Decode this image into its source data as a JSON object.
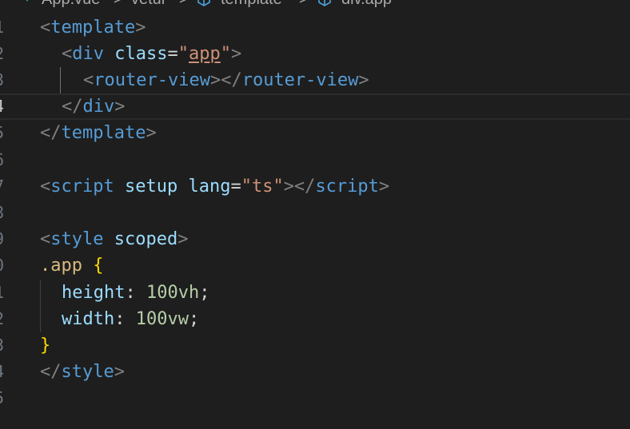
{
  "breadcrumb": {
    "items": [
      "App.vue",
      "vetur",
      "template",
      "div.app"
    ],
    "separator": ">"
  },
  "line_numbers": [
    "1",
    "2",
    "3",
    "4",
    "5",
    "6",
    "7",
    "8",
    "9",
    "0",
    "1",
    "2",
    "3",
    "4",
    "5"
  ],
  "active_line_index": 3,
  "code": {
    "l1": {
      "open": "<",
      "tag": "template",
      "close": ">"
    },
    "l2": {
      "open": "<",
      "tag": "div",
      "attr": "class",
      "eq": "=",
      "q1": "\"",
      "val": "app",
      "q2": "\"",
      "close": ">"
    },
    "l3": {
      "open": "<",
      "tag": "router-view",
      "mid": "></",
      "tag2": "router-view",
      "close": ">"
    },
    "l4": {
      "open": "</",
      "tag": "div",
      "close": ">"
    },
    "l5": {
      "open": "</",
      "tag": "template",
      "close": ">"
    },
    "l7": {
      "open": "<",
      "tag": "script",
      "attr1": "setup",
      "attr2": "lang",
      "eq": "=",
      "val": "\"ts\"",
      "mid": "></",
      "tag2": "script",
      "close": ">"
    },
    "l9": {
      "open": "<",
      "tag": "style",
      "attr": "scoped",
      "close": ">"
    },
    "l10": {
      "selector": ".app",
      "brace": "{"
    },
    "l11": {
      "prop": "height",
      "colon": ":",
      "value": "100vh",
      "semi": ";"
    },
    "l12": {
      "prop": "width",
      "colon": ":",
      "value": "100vw",
      "semi": ";"
    },
    "l13": {
      "brace": "}"
    },
    "l14": {
      "open": "</",
      "tag": "style",
      "close": ">"
    }
  },
  "colors": {
    "background": "#1e1e1e",
    "tag": "#569cd6",
    "attribute": "#9cdcfe",
    "string": "#ce9178",
    "selector": "#d7ba7d",
    "brace": "#ffd700",
    "number": "#b5cea8",
    "vue": "#41b883"
  }
}
